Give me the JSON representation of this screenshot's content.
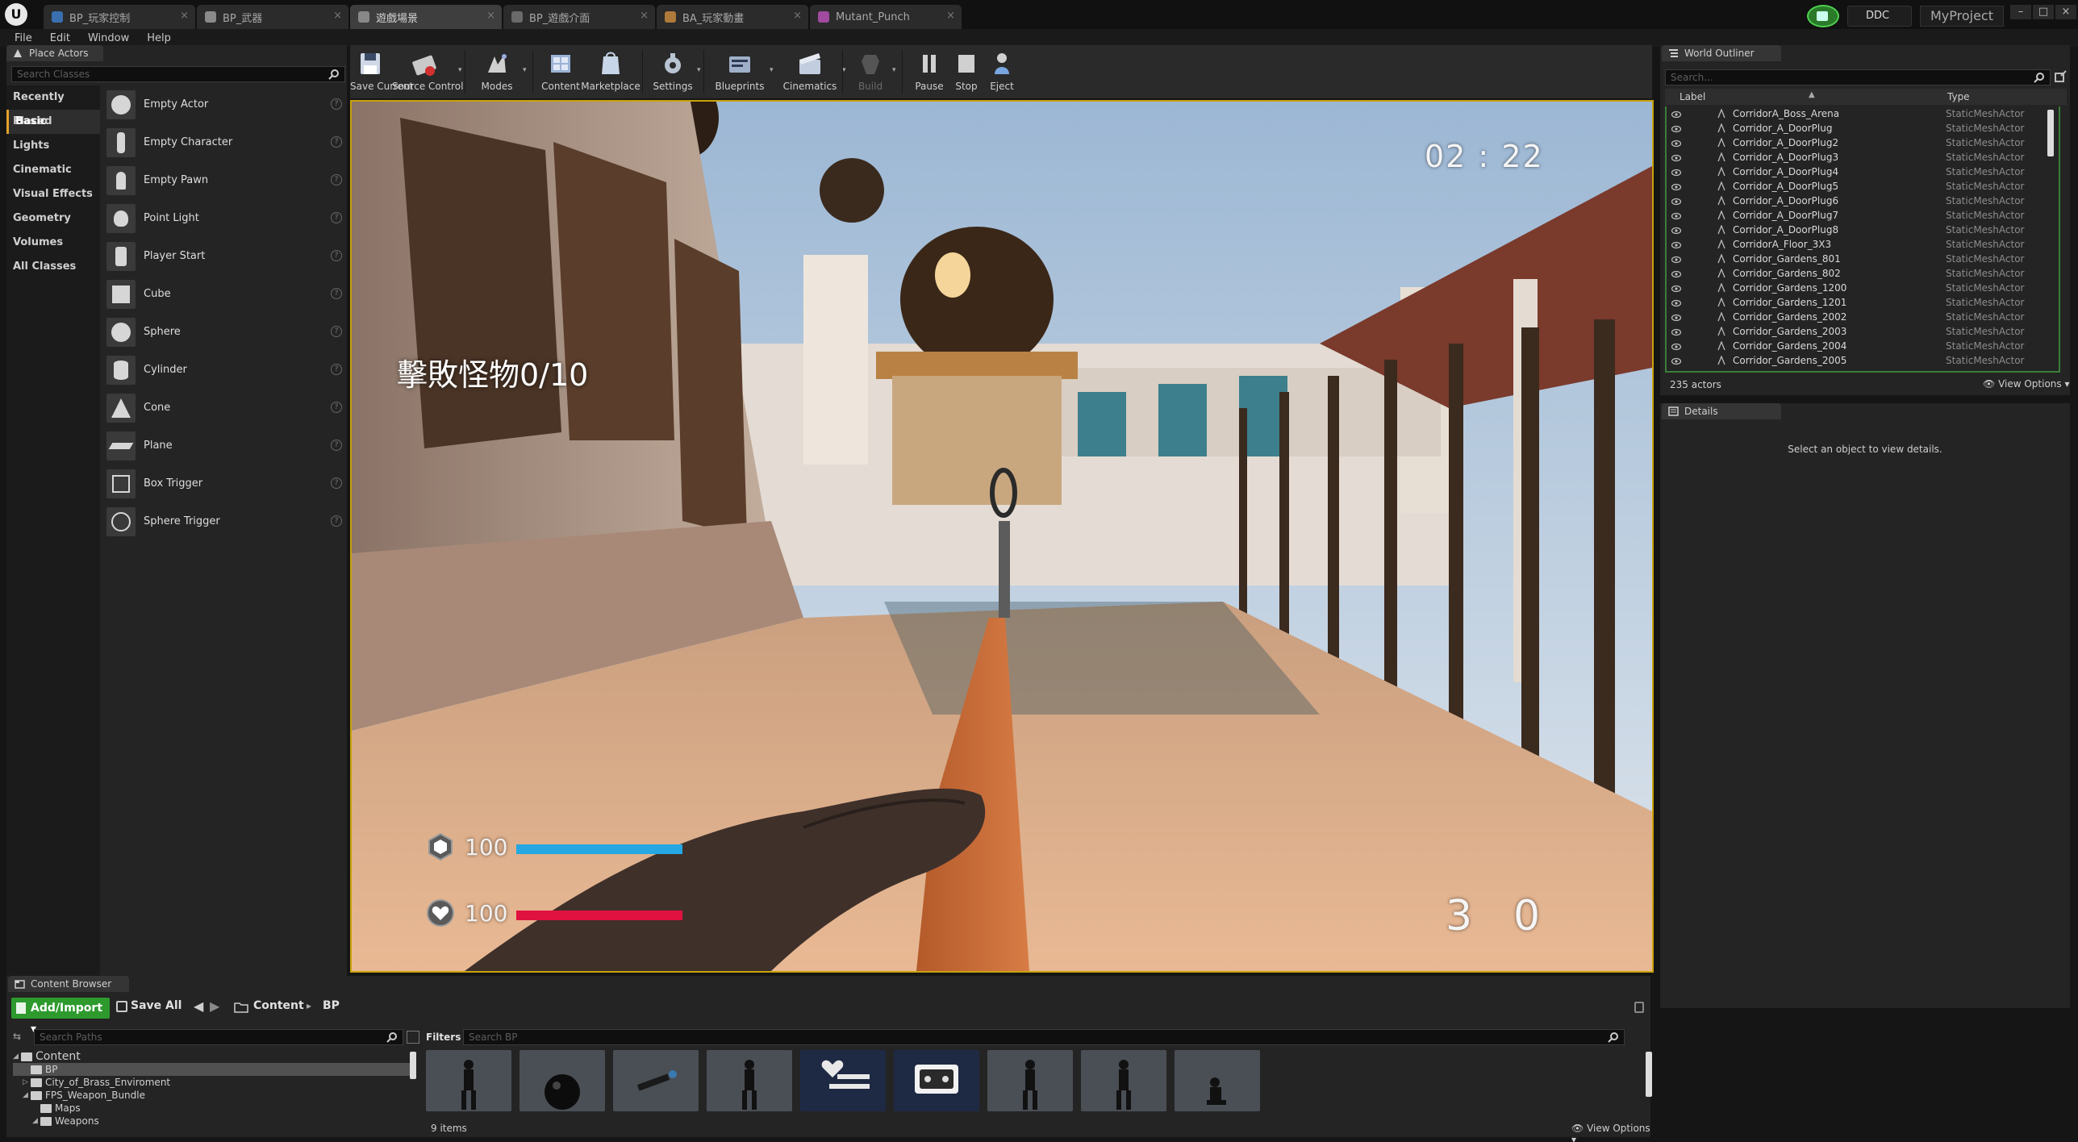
{
  "app": {
    "logo": "U",
    "tabs": [
      {
        "label": "BP_玩家控制",
        "icon": "blueprint-icon",
        "color": "#3a6fb0"
      },
      {
        "label": "BP_武器",
        "icon": "object-icon",
        "color": "#8a8a8a"
      },
      {
        "label": "遊戲場景",
        "icon": "level-icon",
        "color": "#888888"
      },
      {
        "label": "BP_遊戲介面",
        "icon": "widget-icon",
        "color": "#6a6a6a"
      },
      {
        "label": "BA_玩家動畫",
        "icon": "anim-icon",
        "color": "#b07a3a"
      },
      {
        "label": "Mutant_Punch",
        "icon": "montage-icon",
        "color": "#a04aa0"
      }
    ],
    "active_tab_index": 2,
    "ddc_label": "DDC",
    "project_name": "MyProject",
    "window_controls": [
      "–",
      "□",
      "×"
    ]
  },
  "menu": [
    "File",
    "Edit",
    "Window",
    "Help"
  ],
  "place_actors": {
    "tab_label": "Place Actors",
    "search_placeholder": "Search Classes",
    "categories": [
      "Recently Placed",
      "Basic",
      "Lights",
      "Cinematic",
      "Visual Effects",
      "Geometry",
      "Volumes",
      "All Classes"
    ],
    "active_category": "Basic",
    "items": [
      {
        "label": "Empty Actor",
        "icon": "sphere-icon"
      },
      {
        "label": "Empty Character",
        "icon": "character-icon"
      },
      {
        "label": "Empty Pawn",
        "icon": "pawn-icon"
      },
      {
        "label": "Point Light",
        "icon": "light-bulb-icon"
      },
      {
        "label": "Player Start",
        "icon": "player-start-icon"
      },
      {
        "label": "Cube",
        "icon": "cube-icon"
      },
      {
        "label": "Sphere",
        "icon": "sphere-icon"
      },
      {
        "label": "Cylinder",
        "icon": "cylinder-icon"
      },
      {
        "label": "Cone",
        "icon": "cone-icon"
      },
      {
        "label": "Plane",
        "icon": "plane-icon"
      },
      {
        "label": "Box Trigger",
        "icon": "box-trigger-icon"
      },
      {
        "label": "Sphere Trigger",
        "icon": "sphere-trigger-icon"
      }
    ],
    "help_glyph": "?"
  },
  "toolbar": {
    "buttons": [
      {
        "label": "Save Current",
        "icon": "save-icon"
      },
      {
        "label": "Source Control",
        "icon": "source-control-icon"
      },
      {
        "label": "Modes",
        "icon": "modes-icon"
      },
      {
        "label": "Content",
        "icon": "content-icon"
      },
      {
        "label": "Marketplace",
        "icon": "marketplace-icon"
      },
      {
        "label": "Settings",
        "icon": "settings-icon"
      },
      {
        "label": "Blueprints",
        "icon": "blueprints-icon"
      },
      {
        "label": "Cinematics",
        "icon": "cinematics-icon"
      },
      {
        "label": "Build",
        "icon": "build-icon"
      },
      {
        "label": "Pause",
        "icon": "pause-icon"
      },
      {
        "label": "Stop",
        "icon": "stop-icon"
      },
      {
        "label": "Eject",
        "icon": "eject-icon"
      }
    ],
    "dropdown_glyph": "▾"
  },
  "viewport": {
    "hud": {
      "timer": "02 : 22",
      "objective": "擊敗怪物0/10",
      "armor_value": "100",
      "armor_fraction": 1.0,
      "health_value": "100",
      "health_fraction": 1.0,
      "ammo_clip": "3",
      "ammo_reserve": "0"
    },
    "colors": {
      "border": "#c9a20c",
      "armor_bar": "#24a7e2",
      "health_bar": "#e0123f"
    }
  },
  "world_outliner": {
    "tab_label": "World Outliner",
    "search_placeholder": "Search...",
    "col_label": "Label",
    "col_type": "Type",
    "rows": [
      {
        "name": "CorridorA_Boss_Arena",
        "type": "StaticMeshActor"
      },
      {
        "name": "Corridor_A_DoorPlug",
        "type": "StaticMeshActor"
      },
      {
        "name": "Corridor_A_DoorPlug2",
        "type": "StaticMeshActor"
      },
      {
        "name": "Corridor_A_DoorPlug3",
        "type": "StaticMeshActor"
      },
      {
        "name": "Corridor_A_DoorPlug4",
        "type": "StaticMeshActor"
      },
      {
        "name": "Corridor_A_DoorPlug5",
        "type": "StaticMeshActor"
      },
      {
        "name": "Corridor_A_DoorPlug6",
        "type": "StaticMeshActor"
      },
      {
        "name": "Corridor_A_DoorPlug7",
        "type": "StaticMeshActor"
      },
      {
        "name": "Corridor_A_DoorPlug8",
        "type": "StaticMeshActor"
      },
      {
        "name": "CorridorA_Floor_3X3",
        "type": "StaticMeshActor"
      },
      {
        "name": "Corridor_Gardens_801",
        "type": "StaticMeshActor"
      },
      {
        "name": "Corridor_Gardens_802",
        "type": "StaticMeshActor"
      },
      {
        "name": "Corridor_Gardens_1200",
        "type": "StaticMeshActor"
      },
      {
        "name": "Corridor_Gardens_1201",
        "type": "StaticMeshActor"
      },
      {
        "name": "Corridor_Gardens_2002",
        "type": "StaticMeshActor"
      },
      {
        "name": "Corridor_Gardens_2003",
        "type": "StaticMeshActor"
      },
      {
        "name": "Corridor_Gardens_2004",
        "type": "StaticMeshActor"
      },
      {
        "name": "Corridor_Gardens_2005",
        "type": "StaticMeshActor"
      }
    ],
    "actor_count": "235 actors",
    "view_options": "View Options ▾"
  },
  "details": {
    "tab_label": "Details",
    "empty_message": "Select an object to view details."
  },
  "content_browser": {
    "tab_label": "Content Browser",
    "add_import": "Add/Import ▾",
    "save_all": "Save All",
    "back_glyph": "◀",
    "forward_glyph": "▶",
    "crumb_root": "Content",
    "crumb_sep": "▸",
    "crumb_leaf": "BP",
    "path_search_placeholder": "Search Paths",
    "filters": "Filters ▾",
    "asset_search_placeholder": "Search BP",
    "tree": [
      {
        "label": "Content",
        "depth": 0,
        "arrow": "◢",
        "selected": false
      },
      {
        "label": "BP",
        "depth": 1,
        "arrow": "",
        "selected": true
      },
      {
        "label": "City_of_Brass_Enviroment",
        "depth": 1,
        "arrow": "▷",
        "selected": false
      },
      {
        "label": "FPS_Weapon_Bundle",
        "depth": 1,
        "arrow": "◢",
        "selected": false
      },
      {
        "label": "Maps",
        "depth": 2,
        "arrow": "",
        "selected": false
      },
      {
        "label": "Weapons",
        "depth": 2,
        "arrow": "◢",
        "selected": false
      }
    ],
    "assets": [
      {
        "kind": "character"
      },
      {
        "kind": "ball"
      },
      {
        "kind": "lying-character"
      },
      {
        "kind": "character"
      },
      {
        "kind": "hud-widget"
      },
      {
        "kind": "gamepad-widget"
      },
      {
        "kind": "character"
      },
      {
        "kind": "character"
      },
      {
        "kind": "crouch-character"
      }
    ],
    "item_count": "9 items",
    "view_options": "View Options ▾"
  }
}
